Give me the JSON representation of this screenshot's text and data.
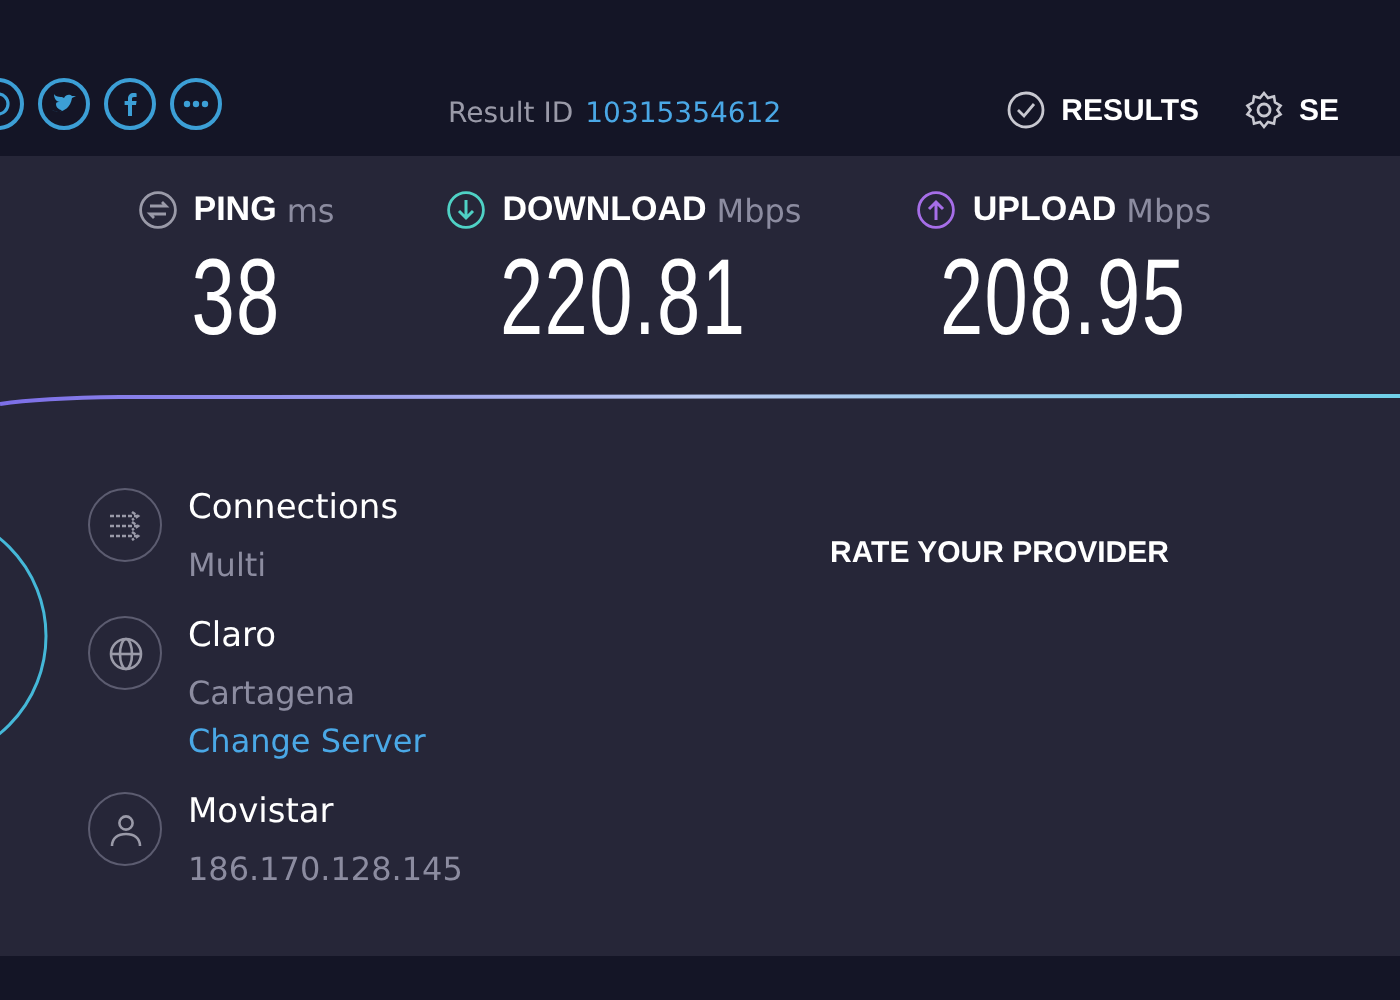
{
  "header": {
    "result_label": "Result ID",
    "result_id": "10315354612",
    "nav": [
      {
        "kind": "results",
        "label": "RESULTS"
      },
      {
        "kind": "settings",
        "label": "SE"
      }
    ]
  },
  "metrics": [
    {
      "kind": "ping",
      "name": "PING",
      "unit": "ms",
      "value": "38"
    },
    {
      "kind": "download",
      "name": "DOWNLOAD",
      "unit": "Mbps",
      "value": "220.81"
    },
    {
      "kind": "upload",
      "name": "UPLOAD",
      "unit": "Mbps",
      "value": "208.95"
    }
  ],
  "details": [
    {
      "kind": "connections",
      "title": "Connections",
      "subtitle": "Multi"
    },
    {
      "kind": "server",
      "title": "Claro",
      "subtitle": "Cartagena",
      "link": "Change Server"
    },
    {
      "kind": "user",
      "title": "Movistar",
      "subtitle": "186.170.128.145"
    }
  ],
  "rate_title": "RATE YOUR PROVIDER"
}
